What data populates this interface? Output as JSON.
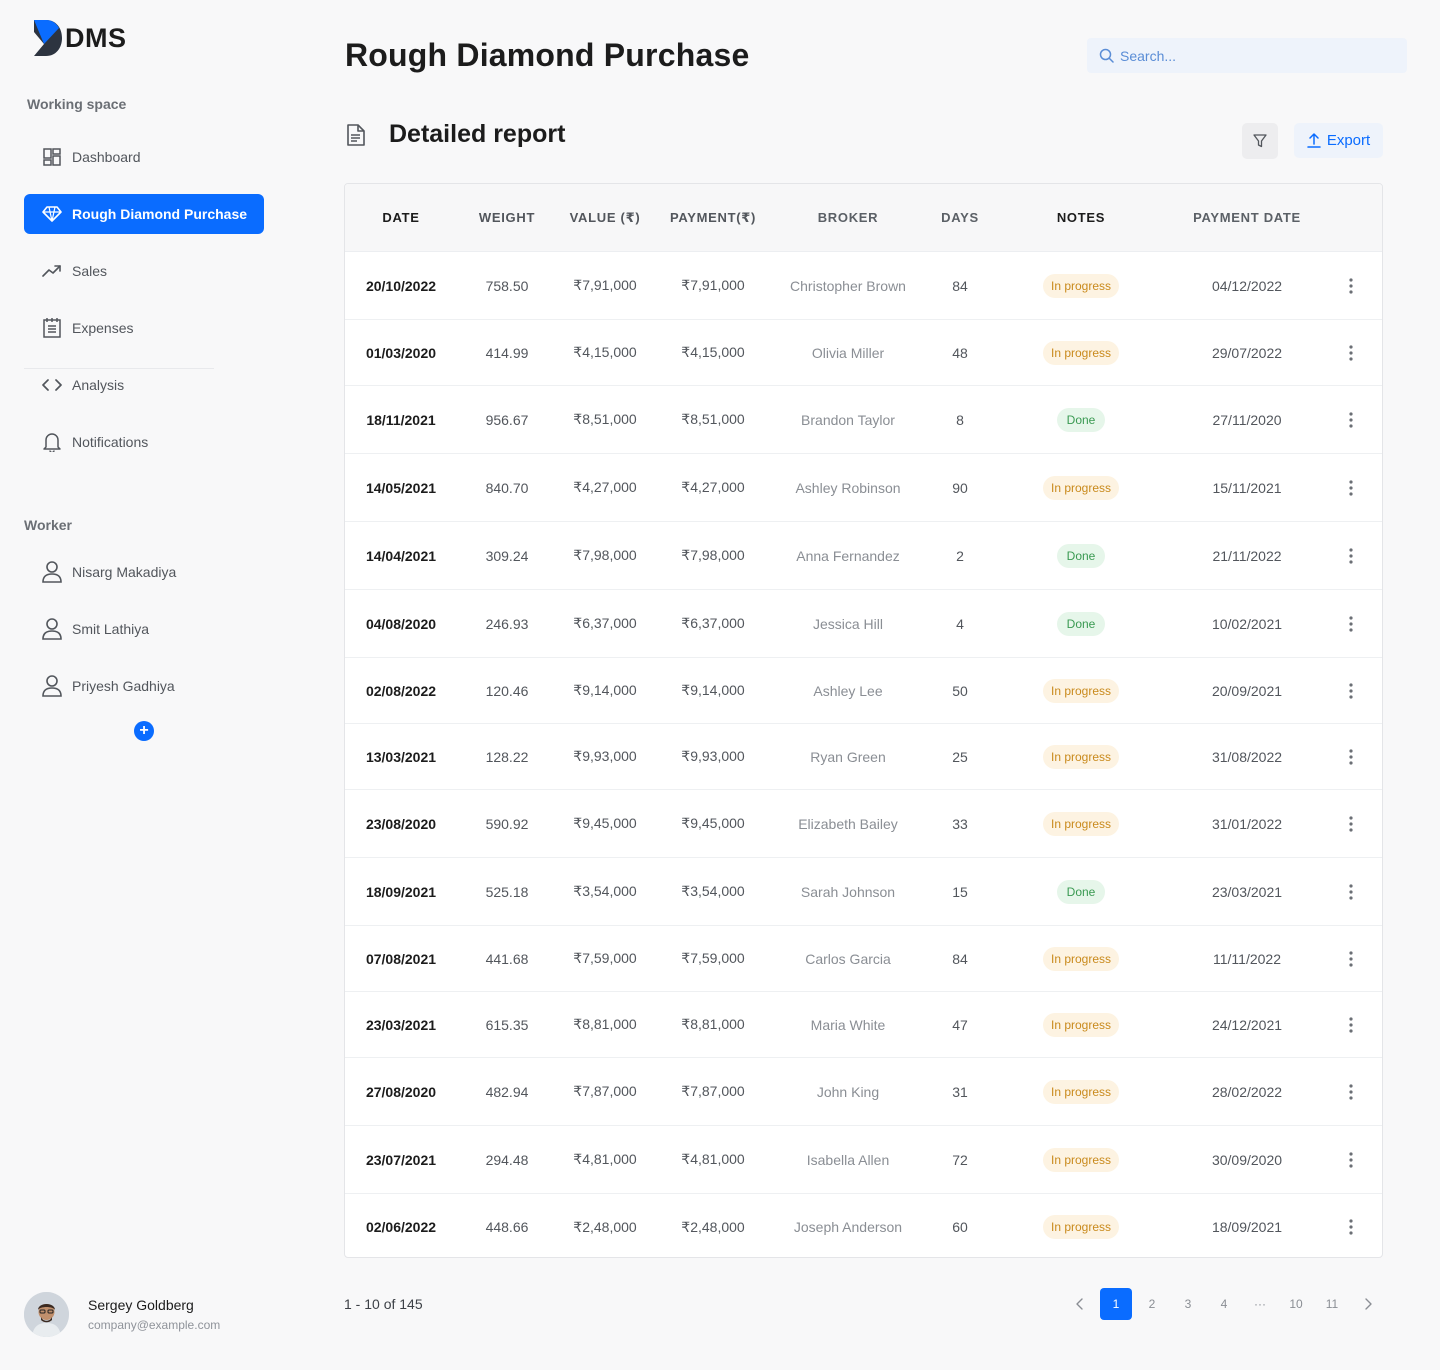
{
  "app": {
    "logo_text": "DMS"
  },
  "sidebar": {
    "working_space_title": "Working space",
    "items": [
      {
        "label": "Dashboard",
        "icon": "dashboard-icon"
      },
      {
        "label": "Rough Diamond Purchase",
        "icon": "diamond-icon",
        "active": true
      },
      {
        "label": "Sales",
        "icon": "trend-up-icon"
      },
      {
        "label": "Expenses",
        "icon": "receipt-icon"
      },
      {
        "label": "Analysis",
        "icon": "code-icon"
      },
      {
        "label": "Notifications",
        "icon": "bell-icon"
      }
    ],
    "worker_title": "Worker",
    "workers": [
      {
        "label": "Nisarg Makadiya",
        "icon": "user-icon"
      },
      {
        "label": "Smit Lathiya",
        "icon": "user-icon"
      },
      {
        "label": "Priyesh Gadhiya",
        "icon": "user-icon"
      }
    ],
    "add_worker_label": "+"
  },
  "profile": {
    "name": "Sergey Goldberg",
    "email": "company@example.com"
  },
  "header": {
    "title": "Rough Diamond Purchase",
    "search_placeholder": "Search..."
  },
  "report": {
    "title": "Detailed report",
    "export_label": "Export"
  },
  "table": {
    "headers": {
      "date": "DATE",
      "weight": "WEIGHT",
      "value": "VALUE (₹)",
      "payment": "PAYMENT(₹)",
      "broker": "BROKER",
      "days": "DAYS",
      "notes": "NOTES",
      "payment_date": "PAYMENT DATE"
    },
    "rows": [
      {
        "date": "20/10/2022",
        "weight": "758.50",
        "value": "₹7,91,000",
        "payment": "₹7,91,000",
        "broker": "Christopher Brown",
        "days": "84",
        "status": "In progress",
        "payment_date": "04/12/2022"
      },
      {
        "date": "01/03/2020",
        "weight": "414.99",
        "value": "₹4,15,000",
        "payment": "₹4,15,000",
        "broker": "Olivia Miller",
        "days": "48",
        "status": "In progress",
        "payment_date": "29/07/2022"
      },
      {
        "date": "18/11/2021",
        "weight": "956.67",
        "value": "₹8,51,000",
        "payment": "₹8,51,000",
        "broker": "Brandon Taylor",
        "days": "8",
        "status": "Done",
        "payment_date": "27/11/2020"
      },
      {
        "date": "14/05/2021",
        "weight": "840.70",
        "value": "₹4,27,000",
        "payment": "₹4,27,000",
        "broker": "Ashley Robinson",
        "days": "90",
        "status": "In progress",
        "payment_date": "15/11/2021"
      },
      {
        "date": "14/04/2021",
        "weight": "309.24",
        "value": "₹7,98,000",
        "payment": "₹7,98,000",
        "broker": "Anna Fernandez",
        "days": "2",
        "status": "Done",
        "payment_date": "21/11/2022"
      },
      {
        "date": "04/08/2020",
        "weight": "246.93",
        "value": "₹6,37,000",
        "payment": "₹6,37,000",
        "broker": "Jessica Hill",
        "days": "4",
        "status": "Done",
        "payment_date": "10/02/2021"
      },
      {
        "date": "02/08/2022",
        "weight": "120.46",
        "value": "₹9,14,000",
        "payment": "₹9,14,000",
        "broker": "Ashley Lee",
        "days": "50",
        "status": "In progress",
        "payment_date": "20/09/2021"
      },
      {
        "date": "13/03/2021",
        "weight": "128.22",
        "value": "₹9,93,000",
        "payment": "₹9,93,000",
        "broker": "Ryan Green",
        "days": "25",
        "status": "In progress",
        "payment_date": "31/08/2022"
      },
      {
        "date": "23/08/2020",
        "weight": "590.92",
        "value": "₹9,45,000",
        "payment": "₹9,45,000",
        "broker": "Elizabeth Bailey",
        "days": "33",
        "status": "In progress",
        "payment_date": "31/01/2022"
      },
      {
        "date": "18/09/2021",
        "weight": "525.18",
        "value": "₹3,54,000",
        "payment": "₹3,54,000",
        "broker": "Sarah Johnson",
        "days": "15",
        "status": "Done",
        "payment_date": "23/03/2021"
      },
      {
        "date": "07/08/2021",
        "weight": "441.68",
        "value": "₹7,59,000",
        "payment": "₹7,59,000",
        "broker": "Carlos Garcia",
        "days": "84",
        "status": "In progress",
        "payment_date": "11/11/2022"
      },
      {
        "date": "23/03/2021",
        "weight": "615.35",
        "value": "₹8,81,000",
        "payment": "₹8,81,000",
        "broker": "Maria White",
        "days": "47",
        "status": "In progress",
        "payment_date": "24/12/2021"
      },
      {
        "date": "27/08/2020",
        "weight": "482.94",
        "value": "₹7,87,000",
        "payment": "₹7,87,000",
        "broker": "John King",
        "days": "31",
        "status": "In progress",
        "payment_date": "28/02/2022"
      },
      {
        "date": "23/07/2021",
        "weight": "294.48",
        "value": "₹4,81,000",
        "payment": "₹4,81,000",
        "broker": "Isabella Allen",
        "days": "72",
        "status": "In progress",
        "payment_date": "30/09/2020"
      },
      {
        "date": "02/06/2022",
        "weight": "448.66",
        "value": "₹2,48,000",
        "payment": "₹2,48,000",
        "broker": "Joseph Anderson",
        "days": "60",
        "status": "In progress",
        "payment_date": "18/09/2021"
      }
    ]
  },
  "pagination": {
    "summary": "1 - 10 of 145",
    "pages": [
      "1",
      "2",
      "3",
      "4",
      "···",
      "10",
      "11"
    ],
    "current": "1"
  },
  "colors": {
    "accent": "#0a6cff",
    "progress": "#c98a1c",
    "done": "#3a9a52"
  }
}
